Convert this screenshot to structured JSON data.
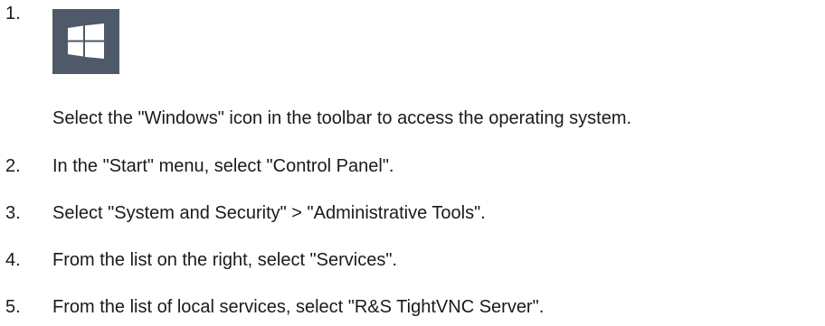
{
  "steps": [
    {
      "number": "1.",
      "text": "Select the \"Windows\" icon in the toolbar to access the operating system."
    },
    {
      "number": "2.",
      "text": "In the \"Start\" menu, select \"Control Panel\"."
    },
    {
      "number": "3.",
      "text": "Select \"System and Security\" > \"Administrative Tools\"."
    },
    {
      "number": "4.",
      "text": "From the list on the right, select \"Services\"."
    },
    {
      "number": "5.",
      "text": "From the list of local services, select \"R&S TightVNC Server\"."
    }
  ],
  "icon": {
    "name": "windows-icon",
    "background": "#4e5a69",
    "tile_color": "#ffffff"
  }
}
